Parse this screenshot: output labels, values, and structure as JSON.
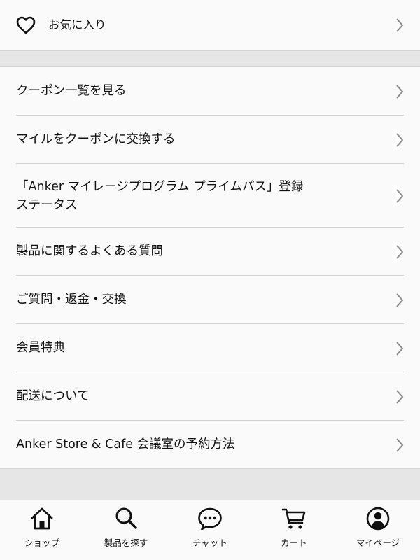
{
  "favorites": {
    "label": "お気に入り",
    "icon": "heart-icon"
  },
  "menu": [
    {
      "key": "coupon-list",
      "label": "クーポン一覧を見る"
    },
    {
      "key": "miles-to-coupon",
      "label": "マイルをクーポンに交換する"
    },
    {
      "key": "prime-pass-status",
      "label": "「Anker マイレージプログラム プライムパス」登録\nステータス"
    },
    {
      "key": "product-faq",
      "label": "製品に関するよくある質問"
    },
    {
      "key": "questions-returns",
      "label": "ご質問・返金・交換"
    },
    {
      "key": "member-benefits",
      "label": "会員特典"
    },
    {
      "key": "shipping",
      "label": "配送について"
    },
    {
      "key": "meeting-room",
      "label": "Anker Store & Cafe 会議室の予約方法"
    }
  ],
  "tabbar": {
    "shop": {
      "label": "ショップ",
      "icon": "home-icon"
    },
    "search": {
      "label": "製品を探す",
      "icon": "search-icon"
    },
    "chat": {
      "label": "チャット",
      "icon": "chat-icon"
    },
    "cart": {
      "label": "カート",
      "icon": "cart-icon"
    },
    "mypage": {
      "label": "マイページ",
      "icon": "user-icon"
    }
  },
  "colors": {
    "background": "#e6e6e6",
    "surface": "#fafafa",
    "text": "#111111",
    "chevron": "#8a8a8a"
  }
}
